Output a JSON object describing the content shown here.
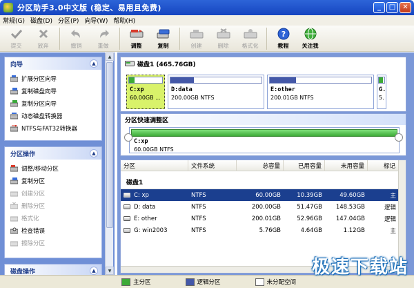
{
  "window": {
    "title": "分区助手3.0中文版 (稳定、易用且免费)"
  },
  "menu": [
    "常规(G)",
    "磁盘(D)",
    "分区(P)",
    "向导(W)",
    "帮助(H)"
  ],
  "toolbar": {
    "items": [
      {
        "label": "提交",
        "icon": "check-icon",
        "disabled": true
      },
      {
        "label": "放弃",
        "icon": "x-icon",
        "disabled": true
      },
      {
        "label": "撤销",
        "icon": "undo-icon",
        "disabled": true
      },
      {
        "label": "重做",
        "icon": "redo-icon",
        "disabled": true
      },
      {
        "label": "调整",
        "icon": "resize-icon",
        "disabled": false
      },
      {
        "label": "复制",
        "icon": "copy-icon",
        "disabled": false
      },
      {
        "label": "创建",
        "icon": "create-icon",
        "disabled": true
      },
      {
        "label": "删除",
        "icon": "delete-icon",
        "disabled": true
      },
      {
        "label": "格式化",
        "icon": "format-icon",
        "disabled": true
      },
      {
        "label": "教程",
        "icon": "help-icon",
        "disabled": false
      },
      {
        "label": "关注我",
        "icon": "follow-icon",
        "disabled": false
      }
    ]
  },
  "sidebar": {
    "wizard": {
      "title": "向导",
      "items": [
        "扩展分区向导",
        "复制磁盘向导",
        "复制分区向导",
        "动态磁盘转换器",
        "NTFS与FAT32转换器"
      ]
    },
    "partition_ops": {
      "title": "分区操作",
      "items": [
        {
          "label": "调整/移动分区",
          "disabled": false
        },
        {
          "label": "复制分区",
          "disabled": false
        },
        {
          "label": "创建分区",
          "disabled": true
        },
        {
          "label": "删除分区",
          "disabled": true
        },
        {
          "label": "格式化",
          "disabled": true
        },
        {
          "label": "检查错误",
          "disabled": false
        },
        {
          "label": "擦除分区",
          "disabled": true
        }
      ]
    },
    "disk_ops": {
      "title": "磁盘操作"
    }
  },
  "disk_map": {
    "disk_label": "磁盘1 (465.76GB)",
    "partitions": [
      {
        "name": "C:xp",
        "info": "60.00GB ...",
        "used_fraction": 0.17,
        "color": "#3daa37",
        "selected": true
      },
      {
        "name": "D:data",
        "info": "200.00GB NTFS",
        "used_fraction": 0.26,
        "color": "#4458a8",
        "selected": false
      },
      {
        "name": "E:other",
        "info": "200.01GB NTFS",
        "used_fraction": 0.26,
        "color": "#4458a8",
        "selected": false
      },
      {
        "name": "G.",
        "info": "5.",
        "used_fraction": 0.8,
        "color": "#3daa37",
        "selected": false
      }
    ]
  },
  "quick_resize": {
    "title": "分区快速调整区",
    "name": "C:xp",
    "info": "60.00GB NTFS"
  },
  "table": {
    "columns": [
      "分区",
      "文件系统",
      "总容量",
      "已用容量",
      "未用容量",
      "标记"
    ],
    "group": "磁盘1",
    "rows": [
      {
        "partition": "C:  xp",
        "fs": "NTFS",
        "total": "60.00GB",
        "used": "10.39GB",
        "free": "49.60GB",
        "flag": "主",
        "selected": true
      },
      {
        "partition": "D:  data",
        "fs": "NTFS",
        "total": "200.00GB",
        "used": "51.47GB",
        "free": "148.53GB",
        "flag": "逻辑",
        "selected": false
      },
      {
        "partition": "E:  other",
        "fs": "NTFS",
        "total": "200.01GB",
        "used": "52.96GB",
        "free": "147.04GB",
        "flag": "逻辑",
        "selected": false
      },
      {
        "partition": "G:  win2003",
        "fs": "NTFS",
        "total": "5.76GB",
        "used": "4.64GB",
        "free": "1.12GB",
        "flag": "主",
        "selected": false
      }
    ]
  },
  "legend": [
    {
      "label": "主分区",
      "color": "#3daa37"
    },
    {
      "label": "逻辑分区",
      "color": "#4458a8"
    },
    {
      "label": "未分配空间",
      "color": "#ffffff"
    }
  ],
  "watermark": "极速下载站"
}
